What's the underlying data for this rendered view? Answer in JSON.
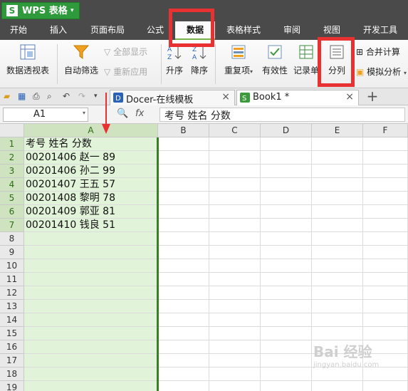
{
  "app": {
    "logo": "S",
    "name": "WPS 表格",
    "caret": "▾"
  },
  "menu": {
    "items": [
      "开始",
      "插入",
      "页面布局",
      "公式",
      "数据",
      "表格样式",
      "审阅",
      "视图",
      "开发工具"
    ],
    "active_index": 4
  },
  "ribbon": {
    "pivot": "数据透视表",
    "autofilter": "自动筛选",
    "show_all": "全部显示",
    "reapply": "重新应用",
    "sort_asc": "升序",
    "sort_desc": "降序",
    "duplicates": "重复项",
    "validity": "有效性",
    "record": "记录单",
    "split": "分列",
    "merge_calc": "合并计算",
    "simulation": "模拟分析"
  },
  "tabs": [
    {
      "title": "Docer-在线模板",
      "icon": "docer-icon",
      "close": "×"
    },
    {
      "title": "Book1 *",
      "icon": "sheet-icon",
      "close": "×"
    }
  ],
  "new_tab": "+",
  "formula": {
    "cell_ref": "A1",
    "fx": "fx",
    "zoom_icon": "🔍",
    "content": "考号 姓名 分数"
  },
  "columns": [
    "A",
    "B",
    "C",
    "D",
    "E",
    "F"
  ],
  "rows": [
    "1",
    "2",
    "3",
    "4",
    "5",
    "6",
    "7",
    "8",
    "9",
    "10",
    "11",
    "12",
    "13",
    "14",
    "15",
    "16",
    "17",
    "18",
    "19"
  ],
  "cells": [
    "考号 姓名 分数",
    "00201406 赵一 89",
    "00201406 孙二 99",
    "00201407 王五 57",
    "00201408 黎明 78",
    "00201409 郭亚 81",
    "00201410 钱良 51"
  ],
  "watermark": {
    "text": "Bai 经验",
    "sub": "jingyan.baidu.com"
  },
  "colors": {
    "highlight": "#e83232",
    "selected_column": "#e1f3d8",
    "accent": "#2f9a3c"
  }
}
